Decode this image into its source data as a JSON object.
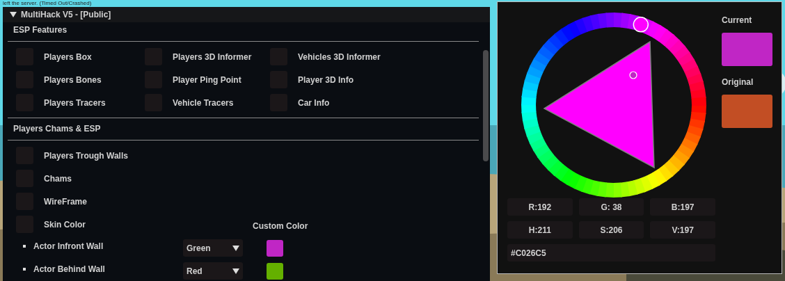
{
  "chat_line": "left the server. (Timed Out/Crashed)",
  "window": {
    "title": "MultiHack V5 - [Public]",
    "expanded": true
  },
  "sections": [
    {
      "title": "ESP Features",
      "kind": "grid",
      "options": [
        {
          "label": "Players Box",
          "checked": false
        },
        {
          "label": "Players 3D Informer",
          "checked": false
        },
        {
          "label": "Vehicles 3D Informer",
          "checked": false
        },
        {
          "label": "Players Bones",
          "checked": false
        },
        {
          "label": "Player Ping Point",
          "checked": false
        },
        {
          "label": "Player 3D Info",
          "checked": false
        },
        {
          "label": "Players Tracers",
          "checked": false
        },
        {
          "label": "Vehicle Tracers",
          "checked": false
        },
        {
          "label": "Car Info",
          "checked": false
        }
      ]
    },
    {
      "title": "Players Chams & ESP",
      "kind": "list",
      "options": [
        {
          "label": "Players Trough Walls",
          "checked": false
        },
        {
          "label": "Chams",
          "checked": false
        },
        {
          "label": "WireFrame",
          "checked": false
        },
        {
          "label": "Skin Color",
          "checked": false
        }
      ]
    }
  ],
  "custom_color_heading": "Custom Color",
  "color_rows": [
    {
      "label": "Actor Infront Wall",
      "dropdown": "Green",
      "color": "#c026c5"
    },
    {
      "label": "Actor Behind Wall",
      "dropdown": "Red",
      "color": "#64b000"
    }
  ],
  "color_picker": {
    "current": {
      "label": "Current",
      "color": "#c026c5"
    },
    "original": {
      "label": "Original",
      "color": "#c24e24"
    },
    "fields": [
      "R:192",
      "G: 38",
      "B:197",
      "H:211",
      "S:206",
      "V:197"
    ],
    "hex": "#C026C5"
  }
}
